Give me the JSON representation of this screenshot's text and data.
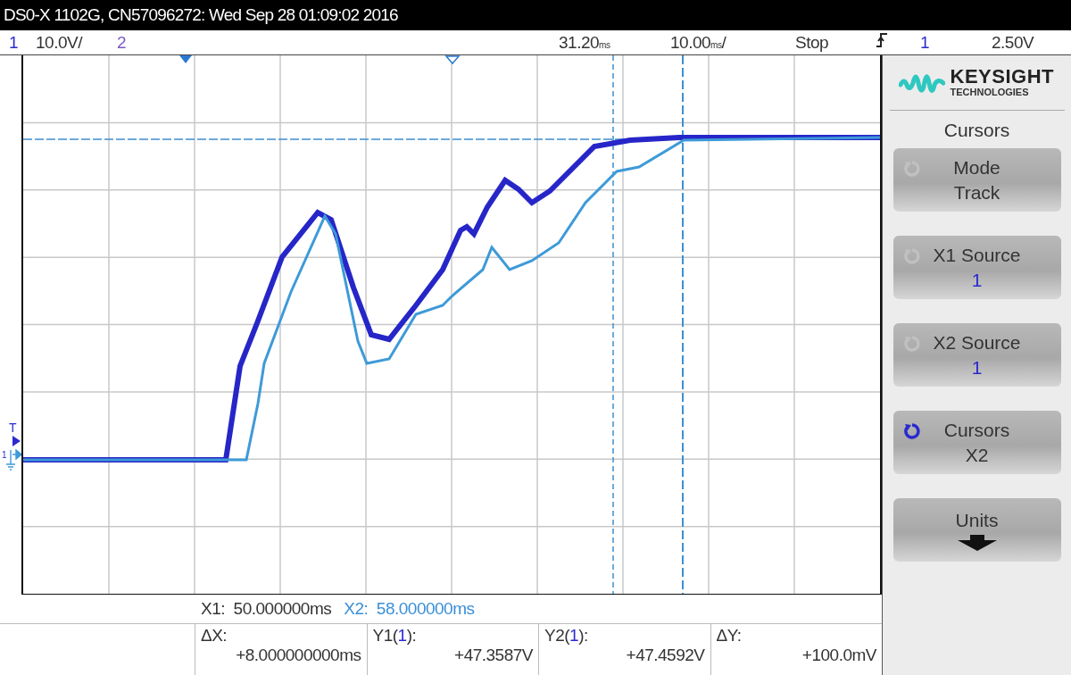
{
  "title_bar": {
    "text": "DS0-X 1102G, CN57096272: Wed Sep 28 01:09:02 2016"
  },
  "info_bar": {
    "channels": [
      {
        "number": "1",
        "scale": "10.0V/"
      },
      {
        "number": "2"
      }
    ],
    "delay": {
      "value": "31.20",
      "unit": "ms"
    },
    "timebase": {
      "value": "10.00",
      "unit": "ms",
      "suffix": "/"
    },
    "run_state": "Stop",
    "trigger": {
      "source": "1",
      "level": "2.50V"
    }
  },
  "plot": {
    "trigger_label": "T",
    "channel_marker": "1"
  },
  "panel": {
    "brand": "KEYSIGHT",
    "brand_sub": "TECHNOLOGIES",
    "title": "Cursors",
    "softkeys": [
      {
        "kind": "value",
        "label": "Mode",
        "value": "Track",
        "knob_active": false,
        "value_blue": false
      },
      {
        "kind": "value",
        "label": "X1 Source",
        "value": "1",
        "knob_active": false,
        "value_blue": true
      },
      {
        "kind": "value",
        "label": "X2 Source",
        "value": "1",
        "knob_active": false,
        "value_blue": true
      },
      {
        "kind": "value",
        "label": "Cursors",
        "value": "X2",
        "knob_active": true,
        "value_blue": false
      },
      {
        "kind": "submenu",
        "label": "Units"
      }
    ]
  },
  "readouts": {
    "x_cursors": [
      {
        "label": "X1:",
        "value": "50.000000ms",
        "blue": false
      },
      {
        "label": "X2:",
        "value": "58.000000ms",
        "blue": true
      }
    ],
    "deltas": [
      {
        "label": [
          "ΔX:"
        ],
        "value": "+8.000000000ms"
      },
      {
        "label": [
          "Y1(",
          "1",
          "):"
        ],
        "value": "+47.3587V"
      },
      {
        "label": [
          "Y2(",
          "1",
          "):"
        ],
        "value": "+47.4592V"
      },
      {
        "label": [
          "ΔY:"
        ],
        "value": "+100.0mV"
      }
    ]
  }
}
